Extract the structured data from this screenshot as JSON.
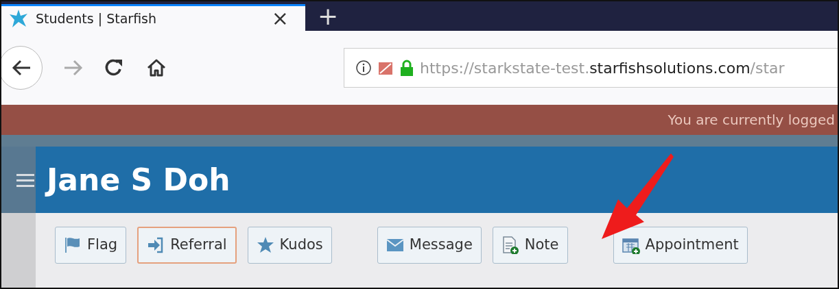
{
  "browser": {
    "tab": {
      "title": "Students | Starfish",
      "close": "×",
      "selected": true
    },
    "new_tab": "+",
    "nav_buttons": [
      {
        "disabled": false
      },
      {
        "disabled": true
      },
      {
        "disabled": false
      },
      {
        "disabled": false
      }
    ],
    "address": {
      "url_prefix": "https://starkstate-test.",
      "url_host": "starfishsolutions.com",
      "url_path": "/star"
    }
  },
  "banner": {
    "text": "You are currently logged"
  },
  "student": {
    "name": "Jane S Doh"
  },
  "action_groups": [
    [
      {
        "label": "Flag",
        "focused": false
      },
      {
        "label": "Referral",
        "focused": true
      },
      {
        "label": "Kudos",
        "focused": false
      }
    ],
    [
      {
        "label": "Message",
        "focused": false
      },
      {
        "label": "Note",
        "focused": false
      }
    ],
    [
      {
        "label": "Appointment",
        "focused": false
      }
    ]
  ]
}
